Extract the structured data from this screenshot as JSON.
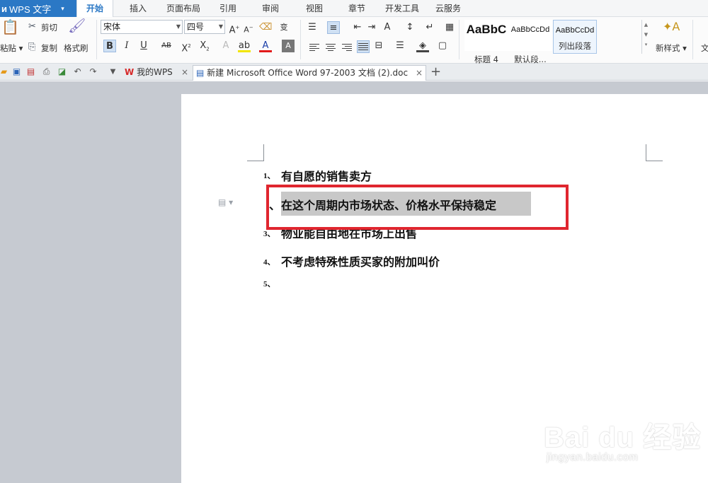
{
  "app": {
    "title": "WPS 文字",
    "menu_arrow": "▾"
  },
  "tabs": [
    "开始",
    "插入",
    "页面布局",
    "引用",
    "审阅",
    "视图",
    "章节",
    "开发工具",
    "云服务"
  ],
  "ribbon": {
    "paste_label": "粘贴",
    "cut_label": "剪切",
    "copy_label": "复制",
    "format_painter_label": "格式刷",
    "font_name": "宋体",
    "font_size": "四号",
    "styles": [
      {
        "preview": "AaBbC",
        "label": "标题 4"
      },
      {
        "preview": "AaBbCcDd",
        "label": "默认段..."
      },
      {
        "preview": "AaBbCcDd",
        "label": "列出段落"
      }
    ],
    "new_style_label": "新样式",
    "cut_off_label": "文"
  },
  "doc_tabs": [
    {
      "label": "我的WPS",
      "close": "×"
    },
    {
      "label": "新建 Microsoft Office Word 97-2003 文档 (2).doc",
      "close": "×"
    }
  ],
  "new_tab": "+",
  "document": {
    "items": [
      {
        "num": "1、",
        "text": "有自愿的销售卖方"
      },
      {
        "num": "、",
        "text": "在这个周期内市场状态、价格水平保持稳定"
      },
      {
        "num": "3、",
        "text": "物业能自由地在市场上出售"
      },
      {
        "num": "4、",
        "text": "不考虑特殊性质买家的附加叫价"
      },
      {
        "num": "5、",
        "text": ""
      }
    ],
    "highlight_color": "#c8c8c8",
    "annotation_color": "#e0262f"
  },
  "watermark": {
    "brand": "Bai  du 经验",
    "url": "jingyan.baidu.com"
  }
}
